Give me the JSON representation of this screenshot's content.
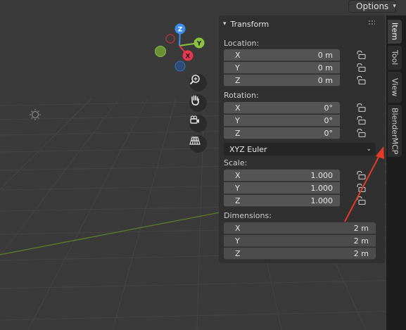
{
  "header": {
    "options_label": "Options"
  },
  "gizmo": {
    "z_label": "Z",
    "y_label": "Y",
    "x_label": "X"
  },
  "panel": {
    "title": "Transform",
    "location": {
      "label": "Location:",
      "rows": [
        {
          "axis": "X",
          "value": "0 m"
        },
        {
          "axis": "Y",
          "value": "0 m"
        },
        {
          "axis": "Z",
          "value": "0 m"
        }
      ]
    },
    "rotation": {
      "label": "Rotation:",
      "rows": [
        {
          "axis": "X",
          "value": "0°"
        },
        {
          "axis": "Y",
          "value": "0°"
        },
        {
          "axis": "Z",
          "value": "0°"
        }
      ],
      "mode": "XYZ Euler"
    },
    "scale": {
      "label": "Scale:",
      "rows": [
        {
          "axis": "X",
          "value": "1.000"
        },
        {
          "axis": "Y",
          "value": "1.000"
        },
        {
          "axis": "Z",
          "value": "1.000"
        }
      ]
    },
    "dimensions": {
      "label": "Dimensions:",
      "rows": [
        {
          "axis": "X",
          "value": "2 m"
        },
        {
          "axis": "Y",
          "value": "2 m"
        },
        {
          "axis": "Z",
          "value": "2 m"
        }
      ]
    }
  },
  "tabs": [
    {
      "label": "Item",
      "active": true
    },
    {
      "label": "Tool",
      "active": false
    },
    {
      "label": "View",
      "active": false
    },
    {
      "label": "BlenderMCP",
      "active": false
    }
  ],
  "colors": {
    "axis_x": "#e8364f",
    "axis_y": "#8ac43f",
    "axis_z": "#3b8ef0",
    "annotation": "#e53a2a"
  }
}
